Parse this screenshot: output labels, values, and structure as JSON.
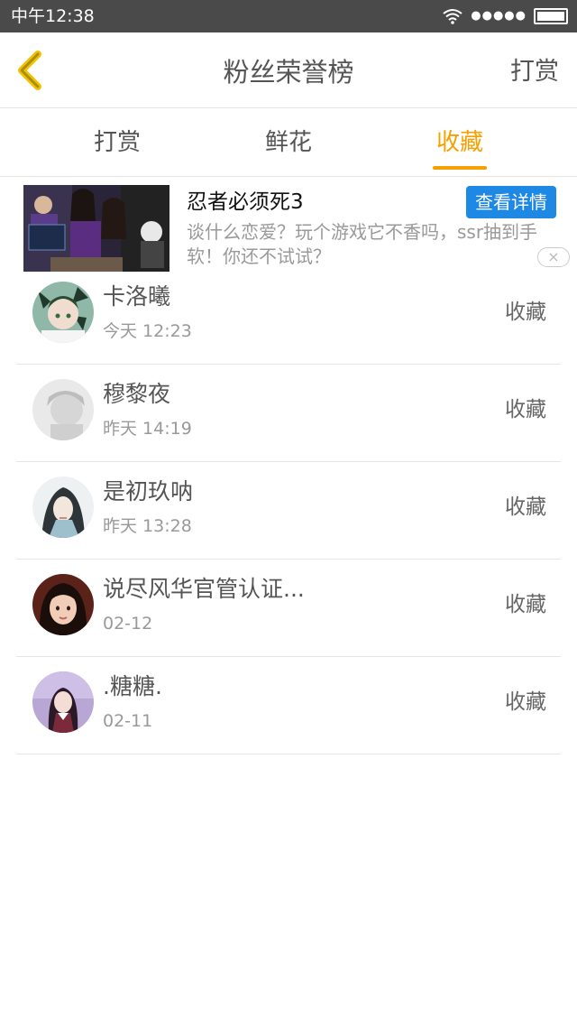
{
  "status_bar": {
    "time": "中午12:38",
    "signal": "●●●●●",
    "battery_level": 1.0
  },
  "nav": {
    "title": "粉丝荣誉榜",
    "right_action": "打赏",
    "back_icon": "chevron-left-icon",
    "accent": "#f5a000"
  },
  "tabs": [
    {
      "label": "打赏",
      "active": false
    },
    {
      "label": "鲜花",
      "active": false
    },
    {
      "label": "收藏",
      "active": true
    }
  ],
  "ad": {
    "title": "忍者必须死3",
    "button": "查看详情",
    "description": "谈什么恋爱？玩个游戏它不香吗，ssr抽到手软！你还不试试？",
    "close_icon": "×"
  },
  "fans": [
    {
      "name": "卡洛曦",
      "time": "今天 12:23",
      "action": "收藏"
    },
    {
      "name": "穆黎夜",
      "time": "昨天 14:19",
      "action": "收藏"
    },
    {
      "name": "是初玖呐",
      "time": "昨天 13:28",
      "action": "收藏"
    },
    {
      "name": "说尽风华官管认证...",
      "time": "02-12",
      "action": "收藏"
    },
    {
      "name": ".糖糖.",
      "time": "02-11",
      "action": "收藏"
    }
  ]
}
